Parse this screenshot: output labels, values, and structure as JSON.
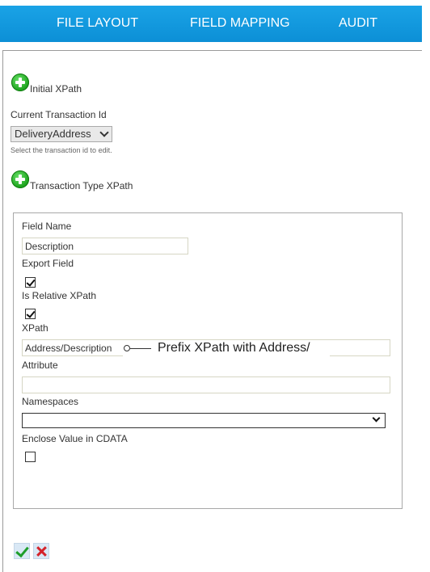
{
  "nav": {
    "tabs": [
      {
        "label": "FILE LAYOUT"
      },
      {
        "label": "FIELD MAPPING"
      },
      {
        "label": "AUDIT"
      }
    ]
  },
  "initial_xpath": {
    "label": "Initial XPath",
    "icon": "add-icon"
  },
  "transaction": {
    "label": "Current Transaction Id",
    "selected": "DeliveryAddress",
    "hint": "Select the transaction id to edit."
  },
  "transaction_type_xpath": {
    "label": "Transaction Type XPath",
    "icon": "add-icon"
  },
  "form": {
    "field_name_label": "Field Name",
    "field_name_value": "Description",
    "export_field_label": "Export Field",
    "export_field_checked": true,
    "is_relative_label": "Is Relative XPath",
    "is_relative_checked": true,
    "xpath_label": "XPath",
    "xpath_value": "Address/Description",
    "attribute_label": "Attribute",
    "attribute_value": "",
    "namespaces_label": "Namespaces",
    "namespaces_value": "",
    "cdata_label": "Enclose Value in CDATA",
    "cdata_checked": false
  },
  "annotation": {
    "text": "Prefix XPath with Address/"
  },
  "actions": {
    "ok_icon": "checkmark-icon",
    "cancel_icon": "x-icon"
  },
  "colors": {
    "nav_bg": "#129ade",
    "plus_green": "#1fa51f",
    "ok_green": "#1e9e2a",
    "cancel_red": "#d4232a"
  }
}
